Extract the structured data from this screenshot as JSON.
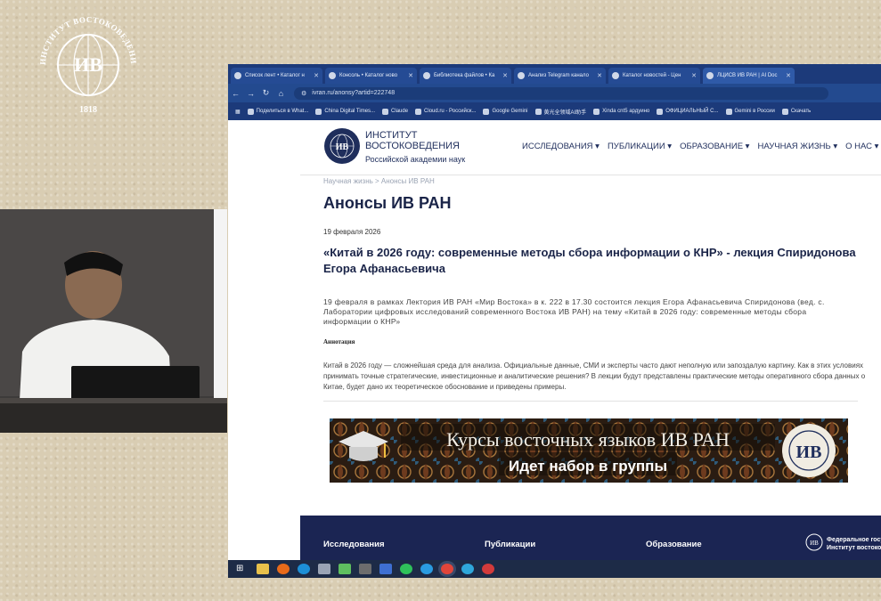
{
  "seal": {
    "name": "ИНСТИТУТ ВОСТОКОВЕДЕНИЯ РАН",
    "monogram": "ИВ",
    "year": "1818"
  },
  "browser": {
    "tabs": [
      {
        "label": "Список лент • Каталог н"
      },
      {
        "label": "Консоль • Каталог ново"
      },
      {
        "label": "Библиотека файлов • Ка"
      },
      {
        "label": "Анализ Telegram канало"
      },
      {
        "label": "Каталог новостей - Цен"
      },
      {
        "label": "ЛЦИСВ ИВ РАН | AI Doc"
      }
    ],
    "url": "ivran.ru/anonsy?artid=222748",
    "bookmarks": [
      {
        "label": "Поделиться в What..."
      },
      {
        "label": "China Digital Times..."
      },
      {
        "label": "Claude"
      },
      {
        "label": "Cloud.ru - Российск..."
      },
      {
        "label": "Google Gemini"
      },
      {
        "label": "黄光全领域AI助手"
      },
      {
        "label": "Xinda cnt5 ардуино"
      },
      {
        "label": "ОФИЦИАЛЬНЫЙ С..."
      },
      {
        "label": "Gemini в России"
      },
      {
        "label": "Скачать"
      }
    ]
  },
  "site": {
    "name_line1": "ИНСТИТУТ",
    "name_line2": "ВОСТОКОВЕДЕНИЯ",
    "subtitle": "Российской академии наук",
    "menu": [
      "ИССЛЕДОВАНИЯ ▾",
      "ПУБЛИКАЦИИ ▾",
      "ОБРАЗОВАНИЕ ▾",
      "НАУЧНАЯ ЖИЗНЬ ▾",
      "О НАС ▾"
    ]
  },
  "article": {
    "breadcrumb": "Научная жизнь  >  Анонсы ИВ РАН",
    "page_title": "Анонсы ИВ РАН",
    "date": "19 февраля 2026",
    "headline": "«Китай в 2026 году: современные методы сбора информации о КНР» - лекция Спиридонова Егора Афанасьевича",
    "lead": "19 февраля в рамках Лектория ИВ РАН «Мир Востока» в к. 222 в 17.30 состоится лекция Егора Афанасьевича Спиридонова (вед. с. Лаборатории цифровых исследований современного Востока ИВ РАН) на тему «Китай в 2026 году: современные методы сбора информации о КНР»",
    "annotation_label": "Аннотация",
    "body": "Китай в 2026 году — сложнейшая среда для анализа. Официальные данные, СМИ и эксперты часто дают неполную или запоздалую картину. Как в этих условиях принимать точные стратегические, инвестиционные и аналитические решения? В лекции будут представлены практические методы оперативного сбора данных о Китае, будет дано их теоретическое обоснование и приведены примеры."
  },
  "banner": {
    "line1": "Курсы восточных языков ИВ РАН",
    "line2": "Идет набор в группы",
    "monogram": "ИВ"
  },
  "footer": {
    "columns": [
      "Исследования",
      "Публикации",
      "Образование"
    ],
    "right_line1": "Федеральное госу",
    "right_line2": "Институт востоков"
  },
  "colors": {
    "navy": "#1b2553",
    "browser_blue": "#1c3a7a",
    "banner_gold": "#c9a04b"
  }
}
